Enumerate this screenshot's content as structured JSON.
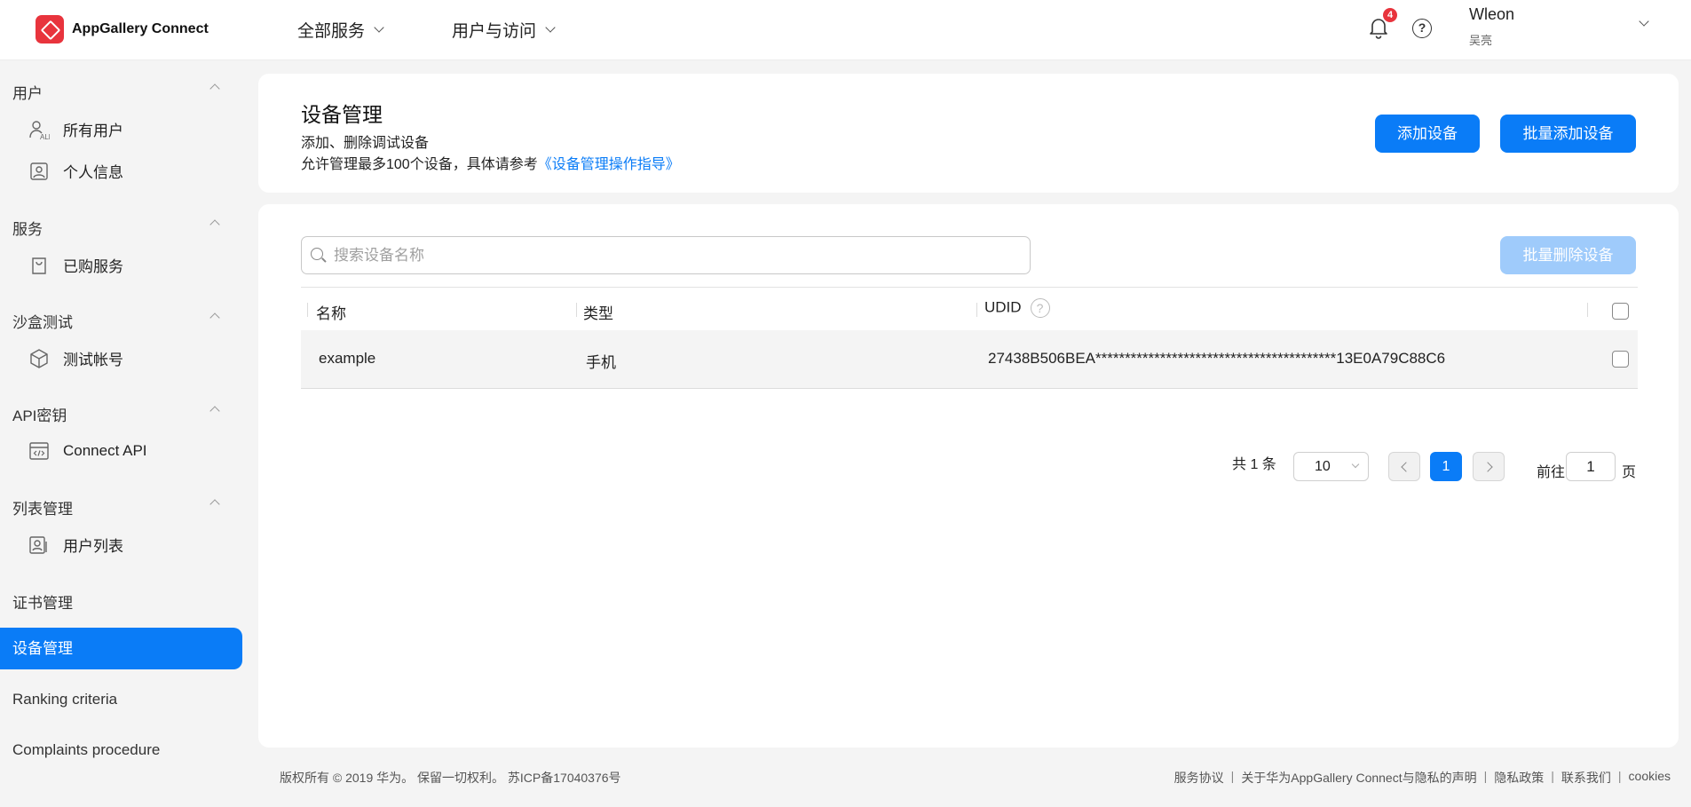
{
  "header": {
    "app_name": "AppGallery Connect",
    "nav": [
      "全部服务",
      "用户与访问"
    ],
    "notification_count": "4",
    "help_glyph": "?",
    "user_name": "Wleon",
    "user_sub": "吴亮"
  },
  "sidebar": {
    "sections": [
      {
        "title": "用户",
        "items": [
          {
            "label": "所有用户",
            "icon": "all-users-icon"
          },
          {
            "label": "个人信息",
            "icon": "personal-info-icon"
          }
        ]
      },
      {
        "title": "服务",
        "items": [
          {
            "label": "已购服务",
            "icon": "shopping-bag-icon"
          }
        ]
      },
      {
        "title": "沙盒测试",
        "items": [
          {
            "label": "测试帐号",
            "icon": "cube-icon"
          }
        ]
      },
      {
        "title": "API密钥",
        "items": [
          {
            "label": "Connect API",
            "icon": "code-window-icon"
          }
        ]
      },
      {
        "title": "列表管理",
        "items": [
          {
            "label": "用户列表",
            "icon": "user-list-icon"
          }
        ]
      }
    ],
    "cert_mgmt": "证书管理",
    "active": "设备管理",
    "ranking": "Ranking criteria",
    "complaints": "Complaints procedure"
  },
  "page": {
    "title": "设备管理",
    "desc1": "添加、删除调试设备",
    "desc2_prefix": "允许管理最多100个设备，具体请参考",
    "desc2_link": "《设备管理操作指导》",
    "add_button": "添加设备",
    "batch_add_button": "批量添加设备",
    "batch_delete_button": "批量删除设备",
    "search_placeholder": "搜索设备名称"
  },
  "table": {
    "columns": [
      "名称",
      "类型",
      "UDID"
    ],
    "udid_help": "?",
    "rows": [
      {
        "name": "example",
        "type": "手机",
        "udid": "27438B506BEA*****************************************13E0A79C88C6"
      }
    ]
  },
  "pagination": {
    "total": "共 1 条",
    "page_size": "10",
    "current": "1",
    "goto_label": "前往",
    "goto_value": "1",
    "page_unit": "页"
  },
  "footer": {
    "copyright": "版权所有 © 2019 华为。 保留一切权利。 苏ICP备17040376号",
    "links": [
      "服务协议",
      "关于华为AppGallery Connect与隐私的声明",
      "隐私政策",
      "联系我们",
      "cookies"
    ]
  },
  "colors": {
    "accent": "#0a7cf7",
    "brand": "#e8343d",
    "badge": "#e8343d"
  }
}
